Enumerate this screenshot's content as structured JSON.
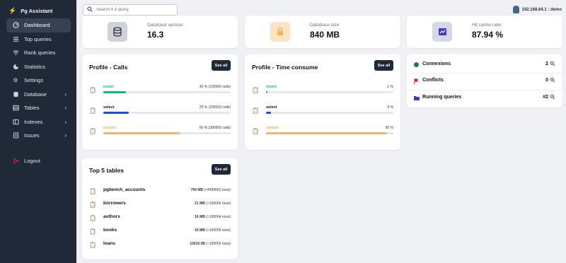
{
  "app": {
    "title": "Pg Assistant"
  },
  "search": {
    "placeholder": "Search 4 a query"
  },
  "user": {
    "label": "192.168.64.1 : demo"
  },
  "sidebar": {
    "items": [
      {
        "label": "Dashboard",
        "icon": "dashboard-icon",
        "active": true
      },
      {
        "label": "Top queries",
        "icon": "list-icon"
      },
      {
        "label": "Rank queries",
        "icon": "signal-icon"
      },
      {
        "label": "Statistics",
        "icon": "stats-icon"
      },
      {
        "label": "Settings",
        "icon": "gear-icon"
      },
      {
        "label": "Database",
        "icon": "database-icon",
        "chevron": true
      },
      {
        "label": "Tables",
        "icon": "table-icon",
        "chevron": true
      },
      {
        "label": "Indexes",
        "icon": "index-icon",
        "chevron": true
      },
      {
        "label": "Issues",
        "icon": "issues-icon",
        "chevron": true
      }
    ],
    "logout": {
      "label": "Logout",
      "icon": "logout-icon"
    }
  },
  "stats": [
    {
      "label": "Database version",
      "value": "16.3",
      "icon": "database-stack-icon",
      "icon_bg": "#cfd3d9"
    },
    {
      "label": "Database size",
      "value": "840 MB",
      "icon": "lock-icon",
      "icon_bg": "#fbe3c4"
    },
    {
      "label": "Hit cache ratio",
      "value": "87.94 %",
      "icon": "chart-icon",
      "icon_bg": "#d6d8e8"
    }
  ],
  "profile_calls": {
    "title": "Profile - Calls",
    "see_all": "See all",
    "rows": [
      {
        "name": "insert",
        "pct_label": "30 % (100000 calls)",
        "fraction": 0.18,
        "color": "#10b981"
      },
      {
        "name": "select",
        "pct_label": "20 % (100018 calls)",
        "fraction": 0.2,
        "color": "#1d4ed8"
      },
      {
        "name": "update",
        "pct_label": "60 % (300000 calls)",
        "fraction": 0.6,
        "color": "#f0b66a"
      }
    ]
  },
  "profile_time": {
    "title": "Profile - Time consume",
    "see_all": "See all",
    "rows": [
      {
        "name": "insert",
        "pct_label": "1 %",
        "fraction": 0.01,
        "color": "#10b981"
      },
      {
        "name": "select",
        "pct_label": "4 %",
        "fraction": 0.04,
        "color": "#1d4ed8"
      },
      {
        "name": "update",
        "pct_label": "95 %",
        "fraction": 0.95,
        "color": "#f0b66a"
      }
    ]
  },
  "connections": {
    "rows": [
      {
        "label": "Connexions",
        "value": "2",
        "marker": "green-dot",
        "color": "#15803d"
      },
      {
        "label": "Conflicts",
        "value": "0",
        "marker": "red-flag",
        "color": "#dc2626"
      },
      {
        "label": "Running queries",
        "value": "#2",
        "marker": "folder",
        "color": "#4338ca"
      }
    ]
  },
  "top_tables": {
    "title": "Top 5 tables",
    "see_all": "See all",
    "rows": [
      {
        "name": "pgbench_accounts",
        "size": "759 MB",
        "rows": "(≈4999892 rows)"
      },
      {
        "name": "borrowers",
        "size": "21 MB",
        "rows": "(≈100003 rows)"
      },
      {
        "name": "authors",
        "size": "16 MB",
        "rows": "(≈100004 rows)"
      },
      {
        "name": "books",
        "size": "15 MB",
        "rows": "(≈100005 rows)"
      },
      {
        "name": "loans",
        "size": "10016 kB",
        "rows": "(≈100002 rows)"
      }
    ]
  }
}
